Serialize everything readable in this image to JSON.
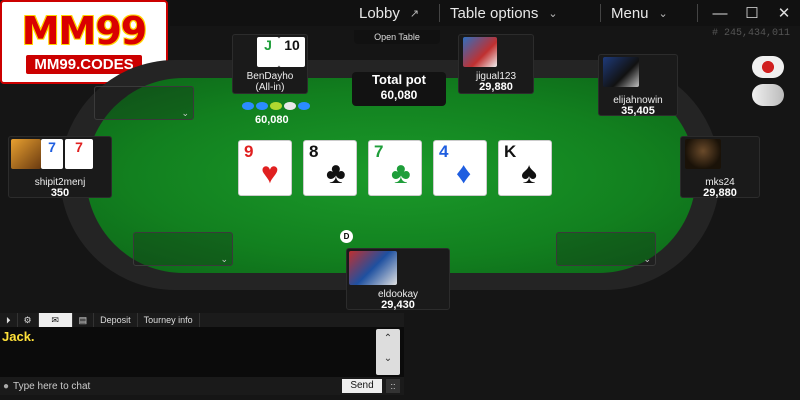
{
  "logo": {
    "mark": "MM99",
    "url": "MM99.CODES"
  },
  "topbar": {
    "lobby_label": "Lobby",
    "lobby_arrow": "↗",
    "table_options_label": "Table options",
    "menu_label": "Menu",
    "chevron": "⌄",
    "minimize": "—",
    "maximize": "☐",
    "close": "✕"
  },
  "table_id": "# 245,434,011",
  "open_table_label": "Open Table",
  "pot": {
    "label": "Total pot",
    "value": "60,080",
    "chips_amount": "60,080"
  },
  "seats": {
    "top_left": {
      "name": "BenDayho",
      "status": "(All-in)",
      "cards": [
        "J",
        "10"
      ]
    },
    "top_right": {
      "name": "jigual123",
      "stack": "29,880"
    },
    "right_top": {
      "name": "elijahnowin",
      "stack": "35,405"
    },
    "right": {
      "name": "mks24",
      "stack": "29,880"
    },
    "bottom": {
      "name": "eldookay",
      "stack": "29,430"
    },
    "left": {
      "name": "shipit2menj",
      "stack": "350",
      "cards": [
        "7",
        "7"
      ]
    }
  },
  "board": [
    {
      "rank": "9",
      "suit": "♥",
      "color": "red"
    },
    {
      "rank": "8",
      "suit": "♣",
      "color": "black"
    },
    {
      "rank": "7",
      "suit": "♣",
      "color": "green"
    },
    {
      "rank": "4",
      "suit": "♦",
      "color": "blue"
    },
    {
      "rank": "K",
      "suit": "♠",
      "color": "black"
    }
  ],
  "dealer_button": "D",
  "chat": {
    "tabs": [
      "⏵",
      "⚙",
      "✉",
      "▤",
      "Deposit",
      "Tourney info"
    ],
    "message": "Jack.",
    "placeholder": "Type here to chat",
    "send_label": "Send",
    "scroll_up": "⌃",
    "scroll_down": "⌄",
    "send_options": "::"
  },
  "colors": {
    "felt": "#12801f",
    "brand": "#d90000",
    "chat_text": "#ffe13a"
  }
}
